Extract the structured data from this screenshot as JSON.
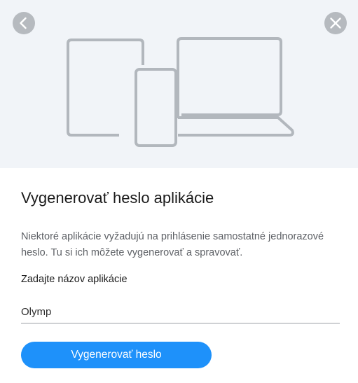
{
  "dialog": {
    "title": "Vygenerovať heslo aplikácie",
    "description": "Niektoré aplikácie vyžadujú na prihlásenie samostatné jednorazové heslo. Tu si ich môžete vygenerovať a spravovať.",
    "field_label": "Zadajte názov aplikácie",
    "app_name_value": "Olymp",
    "generate_button_label": "Vygenerovať heslo"
  },
  "icons": {
    "back": "chevron-left-icon",
    "close": "close-icon",
    "illustration": "devices-illustration"
  },
  "colors": {
    "hero_background": "#f1f4f8",
    "icon_button": "#b6babf",
    "illustration_stroke": "#b2b7bd",
    "primary_button": "#1e91fa"
  }
}
